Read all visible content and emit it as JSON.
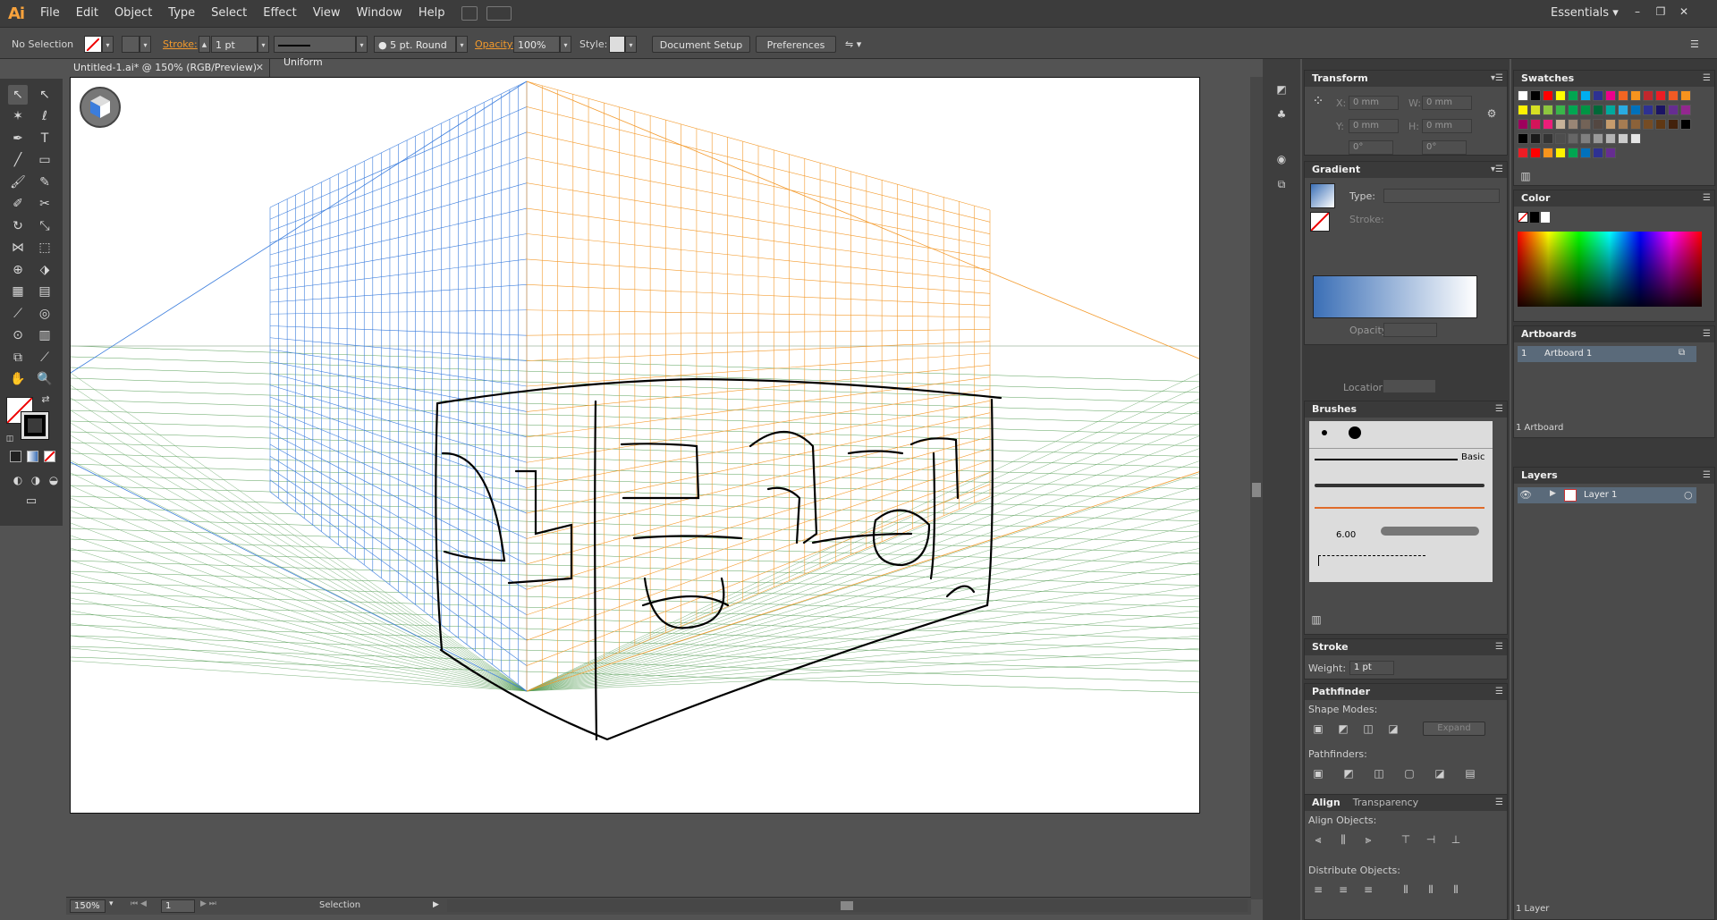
{
  "menubar": {
    "logo": "Ai",
    "items": [
      "File",
      "Edit",
      "Object",
      "Type",
      "Select",
      "Effect",
      "View",
      "Window",
      "Help"
    ],
    "workspace": "Essentials",
    "window_buttons": [
      "–",
      "❐",
      "✕"
    ]
  },
  "control": {
    "selection": "No Selection",
    "stroke_label": "Stroke:",
    "stroke_value": "1 pt",
    "profile": "Uniform",
    "brush": "5 pt. Round",
    "opacity_label": "Opacity:",
    "opacity_value": "100%",
    "style_label": "Style:",
    "document_setup": "Document Setup",
    "preferences": "Preferences"
  },
  "document": {
    "tab_title": "Untitled-1.ai* @ 150% (RGB/Preview)",
    "zoom": "150%",
    "artboard_nav": "1",
    "status": "Selection"
  },
  "transform": {
    "title": "Transform",
    "x_label": "X:",
    "x": "0 mm",
    "y_label": "Y:",
    "y": "0 mm",
    "w_label": "W:",
    "w": "0 mm",
    "h_label": "H:",
    "h": "0 mm",
    "angle1": "0°",
    "angle2": "0°"
  },
  "gradient": {
    "title": "Gradient",
    "type_label": "Type:",
    "stroke_label": "Stroke:",
    "opacity_label": "Opacity:",
    "location_label": "Location:"
  },
  "brushes": {
    "title": "Brushes",
    "basic": "Basic",
    "size": "6.00"
  },
  "stroke_panel": {
    "title": "Stroke",
    "weight_label": "Weight:",
    "weight": "1 pt"
  },
  "pathfinder": {
    "title": "Pathfinder",
    "shape_modes": "Shape Modes:",
    "expand": "Expand",
    "pathfinders": "Pathfinders:"
  },
  "align": {
    "title": "Align",
    "tab2": "Transparency",
    "align_objects": "Align Objects:",
    "distribute_objects": "Distribute Objects:"
  },
  "swatches": {
    "title": "Swatches",
    "row1": [
      "#ffffff",
      "#000000",
      "#ff0000",
      "#ffff00",
      "#00a651",
      "#00aeef",
      "#2e3192",
      "#ec008c",
      "#f26522",
      "#f7941d",
      "#c1272d",
      "#ed1c24",
      "#f15a24",
      "#f7931e"
    ],
    "row2": [
      "#fff200",
      "#d7df23",
      "#8dc63f",
      "#39b54a",
      "#00a651",
      "#009444",
      "#006838",
      "#00a99d",
      "#29abe2",
      "#0071bc",
      "#2e3192",
      "#1b1464",
      "#662d91",
      "#93278f"
    ],
    "row3": [
      "#9e005d",
      "#d4145a",
      "#ed1e79",
      "#c7b299",
      "#998675",
      "#736357",
      "#534741",
      "#c69c6d",
      "#a67c52",
      "#8c6239",
      "#754c24",
      "#603813",
      "#42210b",
      "#000000"
    ],
    "gray": [
      "#000000",
      "#1a1a1a",
      "#333333",
      "#4d4d4d",
      "#666666",
      "#808080",
      "#999999",
      "#b3b3b3",
      "#cccccc",
      "#e6e6e6"
    ],
    "group": [
      "#ed1c24",
      "#ff0000",
      "#f7941d",
      "#fff200",
      "#00a651",
      "#0071bc",
      "#2e3192",
      "#662d91"
    ]
  },
  "color": {
    "title": "Color"
  },
  "artboards": {
    "title": "Artboards",
    "row_num": "1",
    "row_name": "Artboard 1",
    "count": "1 Artboard"
  },
  "layers": {
    "title": "Layers",
    "layer_name": "Layer 1",
    "count": "1 Layer"
  },
  "colors": {
    "orange_grid": "#f39a2c",
    "blue_grid": "#3b7ddd",
    "green_grid": "#5aa05a",
    "accent": "#f39a2c"
  }
}
